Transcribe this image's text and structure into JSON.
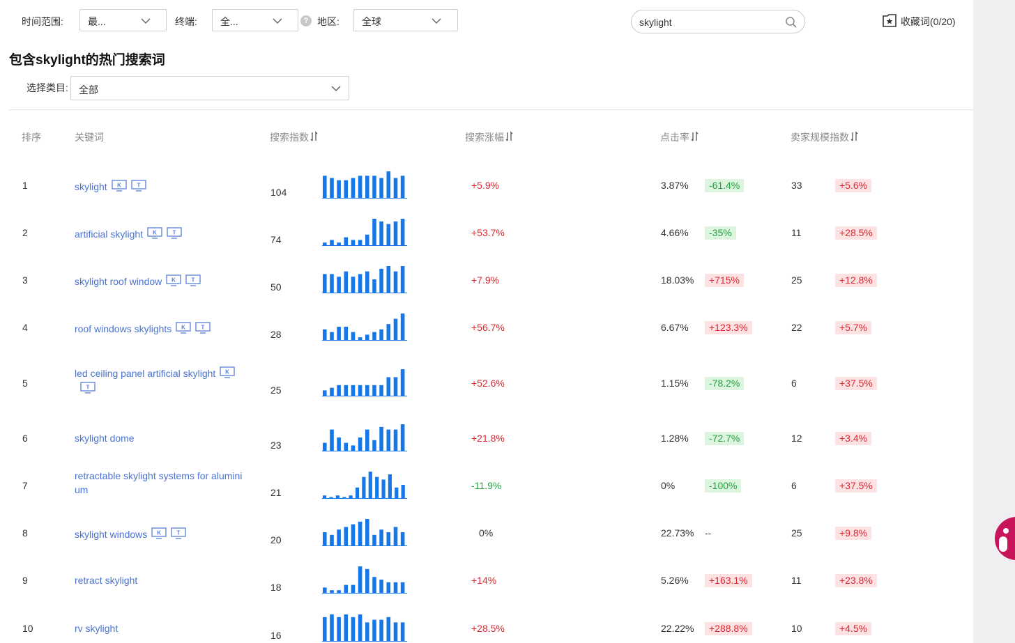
{
  "filters": {
    "time_label": "时间范围:",
    "time_value": "最...",
    "terminal_label": "终端:",
    "terminal_value": "全...",
    "region_label": "地区:",
    "region_value": "全球",
    "help_glyph": "?"
  },
  "search": {
    "value": "skylight",
    "icon": "search-icon"
  },
  "favorites": {
    "label": "收藏词(0/20)",
    "icon": "star-folder-icon"
  },
  "page_title": "包含skylight的热门搜索词",
  "category": {
    "label": "选择类目:",
    "value": "全部"
  },
  "table": {
    "headers": {
      "rank": "排序",
      "keyword": "关键词",
      "search_index": "搜索指数",
      "search_growth": "搜索涨幅",
      "ctr": "点击率",
      "seller_index": "卖家规模指数"
    },
    "icon_letters": {
      "k": "K",
      "t": "T"
    },
    "colors": {
      "bar": "#1677e8",
      "positive": "#e0262f",
      "negative": "#21a33e",
      "link": "#4a73d4"
    },
    "rows": [
      {
        "rank": "1",
        "keyword_lines": [
          "skylight"
        ],
        "icons": [
          "K",
          "T"
        ],
        "search_index": "104",
        "trend": [
          10,
          9,
          8,
          8,
          9,
          10,
          10,
          10,
          9,
          12,
          9,
          10
        ],
        "growth": "+5.9%",
        "growth_sign": "pos",
        "ctr": "3.87%",
        "ctr_change": "-61.4%",
        "ctr_sign": "neg",
        "seller_index": "33",
        "seller_change": "+5.6%",
        "seller_sign": "pos"
      },
      {
        "rank": "2",
        "keyword_lines": [
          "artificial skylight"
        ],
        "icons": [
          "K",
          "T"
        ],
        "search_index": "74",
        "trend": [
          1,
          2,
          1,
          3,
          2,
          2,
          4,
          10,
          9,
          8,
          9,
          10
        ],
        "growth": "+53.7%",
        "growth_sign": "pos",
        "ctr": "4.66%",
        "ctr_change": "-35%",
        "ctr_sign": "neg",
        "seller_index": "11",
        "seller_change": "+28.5%",
        "seller_sign": "pos"
      },
      {
        "rank": "3",
        "keyword_lines": [
          "skylight roof window"
        ],
        "icons": [
          "K",
          "T"
        ],
        "search_index": "50",
        "trend": [
          7,
          7,
          6,
          8,
          6,
          7,
          8,
          5,
          9,
          10,
          8,
          10
        ],
        "growth": "+7.9%",
        "growth_sign": "pos",
        "ctr": "18.03%",
        "ctr_change": "+715%",
        "ctr_sign": "pos",
        "seller_index": "25",
        "seller_change": "+12.8%",
        "seller_sign": "pos"
      },
      {
        "rank": "4",
        "keyword_lines": [
          "roof windows skylights"
        ],
        "icons": [
          "K",
          "T"
        ],
        "search_index": "28",
        "trend": [
          4,
          3,
          5,
          5,
          3,
          1,
          2,
          3,
          4,
          6,
          8,
          10
        ],
        "growth": "+56.7%",
        "growth_sign": "pos",
        "ctr": "6.67%",
        "ctr_change": "+123.3%",
        "ctr_sign": "pos",
        "seller_index": "22",
        "seller_change": "+5.7%",
        "seller_sign": "pos"
      },
      {
        "rank": "5",
        "keyword_lines": [
          "led ceiling panel artificial skylight"
        ],
        "icons": [
          "K",
          "T"
        ],
        "search_index": "25",
        "trend": [
          2,
          3,
          4,
          4,
          4,
          4,
          4,
          4,
          4,
          7,
          7,
          10
        ],
        "growth": "+52.6%",
        "growth_sign": "pos",
        "ctr": "1.15%",
        "ctr_change": "-78.2%",
        "ctr_sign": "neg",
        "seller_index": "6",
        "seller_change": "+37.5%",
        "seller_sign": "pos"
      },
      {
        "rank": "6",
        "keyword_lines": [
          "skylight dome"
        ],
        "icons": [],
        "search_index": "23",
        "trend": [
          3,
          8,
          5,
          3,
          2,
          5,
          8,
          4,
          9,
          8,
          8,
          10
        ],
        "growth": "+21.8%",
        "growth_sign": "pos",
        "ctr": "1.28%",
        "ctr_change": "-72.7%",
        "ctr_sign": "neg",
        "seller_index": "12",
        "seller_change": "+3.4%",
        "seller_sign": "pos"
      },
      {
        "rank": "7",
        "keyword_lines": [
          "retractable skylight systems for alumini",
          "um"
        ],
        "icons": [],
        "search_index": "21",
        "trend": [
          1,
          0,
          1,
          0,
          1,
          4,
          8,
          10,
          8,
          7,
          9,
          4,
          5
        ],
        "growth": "-11.9%",
        "growth_sign": "neg",
        "ctr": "0%",
        "ctr_change": "-100%",
        "ctr_sign": "neg",
        "seller_index": "6",
        "seller_change": "+37.5%",
        "seller_sign": "pos"
      },
      {
        "rank": "8",
        "keyword_lines": [
          "skylight windows"
        ],
        "icons": [
          "K",
          "T"
        ],
        "search_index": "20",
        "trend": [
          5,
          4,
          6,
          7,
          8,
          9,
          10,
          4,
          6,
          5,
          7,
          5
        ],
        "growth": "0%",
        "growth_sign": "none",
        "ctr": "22.73%",
        "ctr_change": "--",
        "ctr_sign": "none",
        "seller_index": "25",
        "seller_change": "+9.8%",
        "seller_sign": "pos"
      },
      {
        "rank": "9",
        "keyword_lines": [
          "retract skylight"
        ],
        "icons": [],
        "search_index": "18",
        "trend": [
          2,
          1,
          1,
          3,
          3,
          10,
          9,
          6,
          5,
          4,
          4,
          4
        ],
        "growth": "+14%",
        "growth_sign": "pos",
        "ctr": "5.26%",
        "ctr_change": "+163.1%",
        "ctr_sign": "pos",
        "seller_index": "11",
        "seller_change": "+23.8%",
        "seller_sign": "pos"
      },
      {
        "rank": "10",
        "keyword_lines": [
          "rv skylight"
        ],
        "icons": [],
        "search_index": "16",
        "trend": [
          9,
          10,
          9,
          10,
          9,
          10,
          7,
          8,
          8,
          9,
          7,
          7
        ],
        "growth": "+28.5%",
        "growth_sign": "pos",
        "ctr": "22.22%",
        "ctr_change": "+288.8%",
        "ctr_sign": "pos",
        "seller_index": "10",
        "seller_change": "+4.5%",
        "seller_sign": "pos"
      }
    ]
  }
}
